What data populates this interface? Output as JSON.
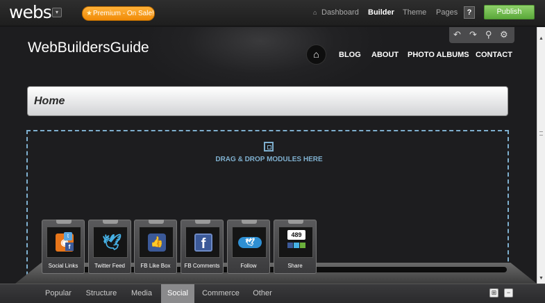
{
  "topbar": {
    "logo": "webs",
    "logo_menu_icon": "▾",
    "premium_label": "Premium - On Sale!",
    "nav": [
      "Dashboard",
      "Builder",
      "Theme",
      "Pages"
    ],
    "help_label": "?",
    "publish_label": "Publish"
  },
  "site": {
    "title": "WebBuildersGuide",
    "nav": [
      "BLOG",
      "ABOUT",
      "PHOTO ALBUMS",
      "CONTACT"
    ],
    "page_heading": "Home",
    "drop_text": "DRAG & DROP MODULES HERE"
  },
  "modules": [
    {
      "label": "Social Links",
      "icon": "social-links-icon"
    },
    {
      "label": "Twitter Feed",
      "icon": "twitter-feed-icon"
    },
    {
      "label": "FB Like Box",
      "icon": "fb-like-box-icon"
    },
    {
      "label": "FB Comments",
      "icon": "fb-comments-icon"
    },
    {
      "label": "Follow",
      "icon": "follow-icon"
    },
    {
      "label": "Share",
      "icon": "share-icon",
      "count": "489"
    }
  ],
  "bottom_tabs": [
    "Popular",
    "Structure",
    "Media",
    "Social",
    "Commerce",
    "Other"
  ],
  "active_tab": "Social",
  "colors": {
    "accent": "#7fb0cf",
    "publish": "#6fbf4e",
    "premium": "#f59a1a"
  }
}
